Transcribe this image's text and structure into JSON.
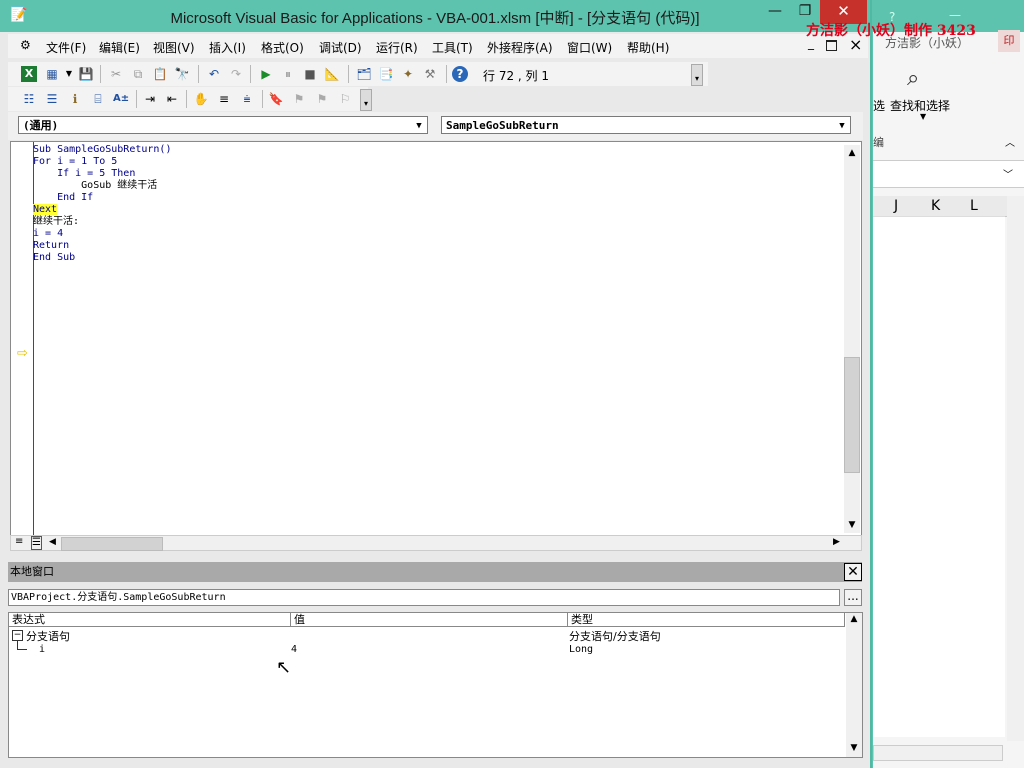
{
  "window": {
    "title": "Microsoft Visual Basic for Applications - VBA-001.xlsm [中断] - [分支语句 (代码)]",
    "min_glyph": "—",
    "restore_glyph": "❐",
    "close_glyph": "✕",
    "inner_min": "_",
    "inner_restore": "🗗",
    "inner_close": "×"
  },
  "watermark": "方洁影（小妖）制作 3423",
  "menu": [
    "文件(F)",
    "编辑(E)",
    "视图(V)",
    "插入(I)",
    "格式(O)",
    "调试(D)",
    "运行(R)",
    "工具(T)",
    "外接程序(A)",
    "窗口(W)",
    "帮助(H)"
  ],
  "toolbar": {
    "position": "行 72 , 列 1"
  },
  "combos": {
    "object": "(通用)",
    "procedure": "SampleGoSubReturn"
  },
  "code_lines": [
    "Sub SampleGoSubReturn()",
    "For i = 1 To 5",
    "    If i = 5 Then",
    "        GoSub 继续干活",
    "    End If",
    "Next",
    "继续干活:",
    "i = 4",
    "Return",
    "End Sub"
  ],
  "locals": {
    "title": "本地窗口",
    "context": "VBAProject.分支语句.SampleGoSubReturn",
    "context_btn": "...",
    "headers": {
      "expr": "表达式",
      "value": "值",
      "type": "类型"
    },
    "rows": [
      {
        "expr": "分支语句",
        "value": "",
        "type": "分支语句/分支语句"
      },
      {
        "expr": "i",
        "value": "4",
        "type": "Long"
      }
    ]
  },
  "excel": {
    "user": "方洁影（小妖）",
    "find_select": "查找和选择",
    "select_partial": "选",
    "edit_partial": "编",
    "columns": [
      "J",
      "K",
      "L"
    ]
  }
}
